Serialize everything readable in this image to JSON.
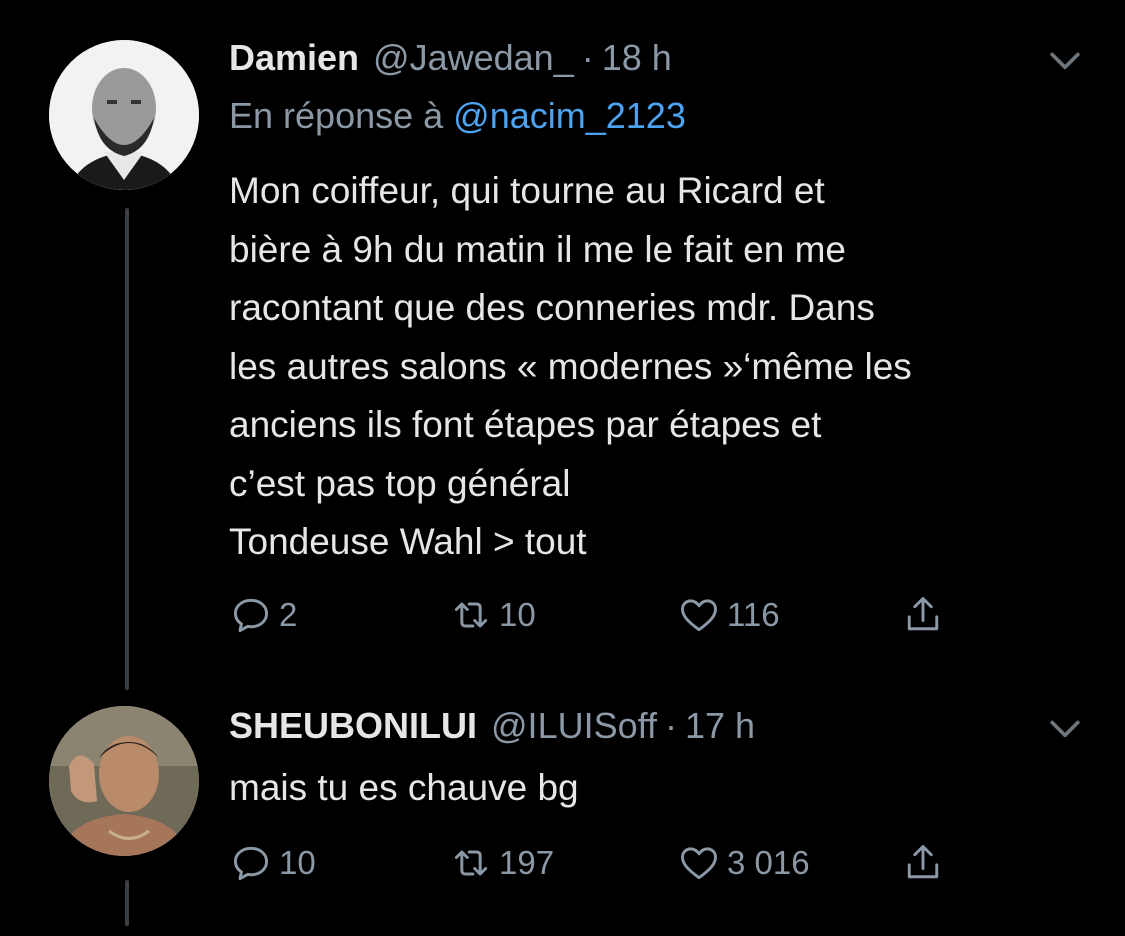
{
  "tweets": [
    {
      "name": "Damien",
      "handle": "@Jawedan_",
      "separator": "·",
      "time": "18 h",
      "reply_prefix": "En réponse à",
      "reply_to": "@nacim_2123",
      "text": "Mon coiffeur, qui tourne au Ricard et\nbière à 9h du matin il me le fait en me\nracontant que des conneries mdr. Dans\nles autres salons « modernes »‘même les\nanciens ils font étapes par étapes et\nc’est pas top général\nTondeuse Wahl > tout",
      "replies": "2",
      "retweets": "10",
      "likes": "116"
    },
    {
      "name": "SHEUBONILUI",
      "handle": "@ILUISoff",
      "separator": "·",
      "time": "17 h",
      "text": "mais tu es chauve bg",
      "replies": "10",
      "retweets": "197",
      "likes": "3 016"
    }
  ],
  "colors": {
    "background": "#000000",
    "text": "#e6e6e6",
    "secondary": "#8b98a5",
    "link": "#4da3ef",
    "thread_line": "#3a3f44"
  },
  "icons": [
    "chevron-down-icon",
    "reply-icon",
    "retweet-icon",
    "like-icon",
    "share-icon"
  ]
}
